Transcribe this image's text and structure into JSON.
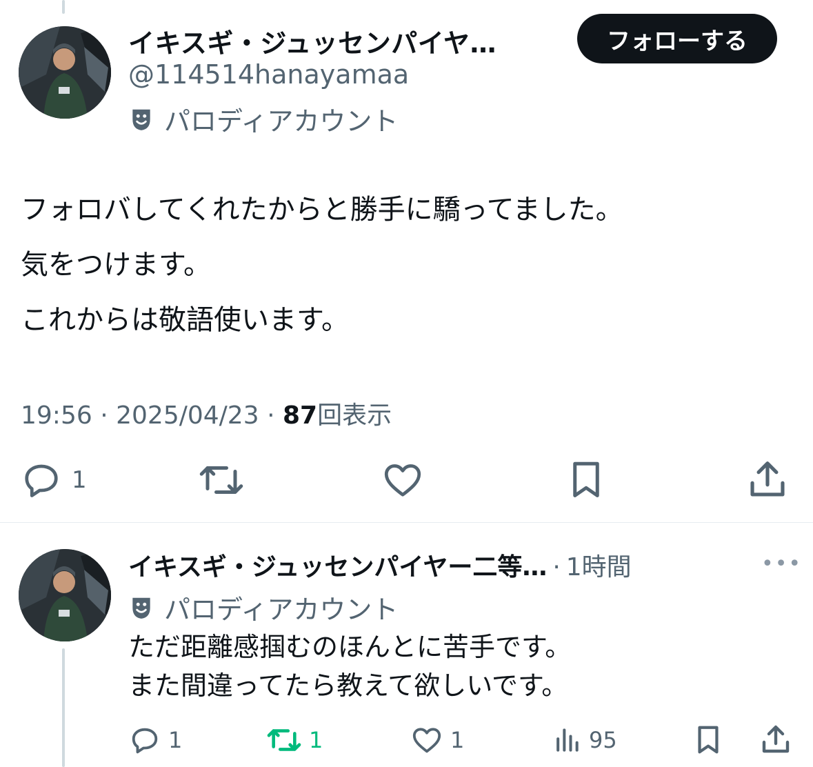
{
  "tweet": {
    "author_name": "イキスギ・ジュッセンパイヤ…",
    "handle": "@114514hanayamaa",
    "parody_label": "パロディアカウント",
    "follow_label": "フォローする",
    "lines": [
      "フォロバしてくれたからと勝手に驕ってました。",
      "気をつけます。",
      "これからは敬語使います。"
    ],
    "time": "19:56",
    "date": "2025/04/23",
    "views_count": "87",
    "views_label": "回表示",
    "separator": "·",
    "reply_count": "1"
  },
  "reply": {
    "author_name": "イキスギ・ジュッセンパイヤー二等…",
    "time_sep": "·",
    "time": "1時間",
    "parody_label": "パロディアカウント",
    "lines": [
      "ただ距離感掴むのほんとに苦手です。",
      "また間違ってたら教えて欲しいです。"
    ],
    "reply_count": "1",
    "retweet_count": "1",
    "like_count": "1",
    "views_count": "95",
    "more_label": "•••"
  },
  "colors": {
    "text": "#0f1419",
    "muted": "#536471",
    "retweet_active": "#00ba7c",
    "thread_line": "#cfd9de"
  }
}
